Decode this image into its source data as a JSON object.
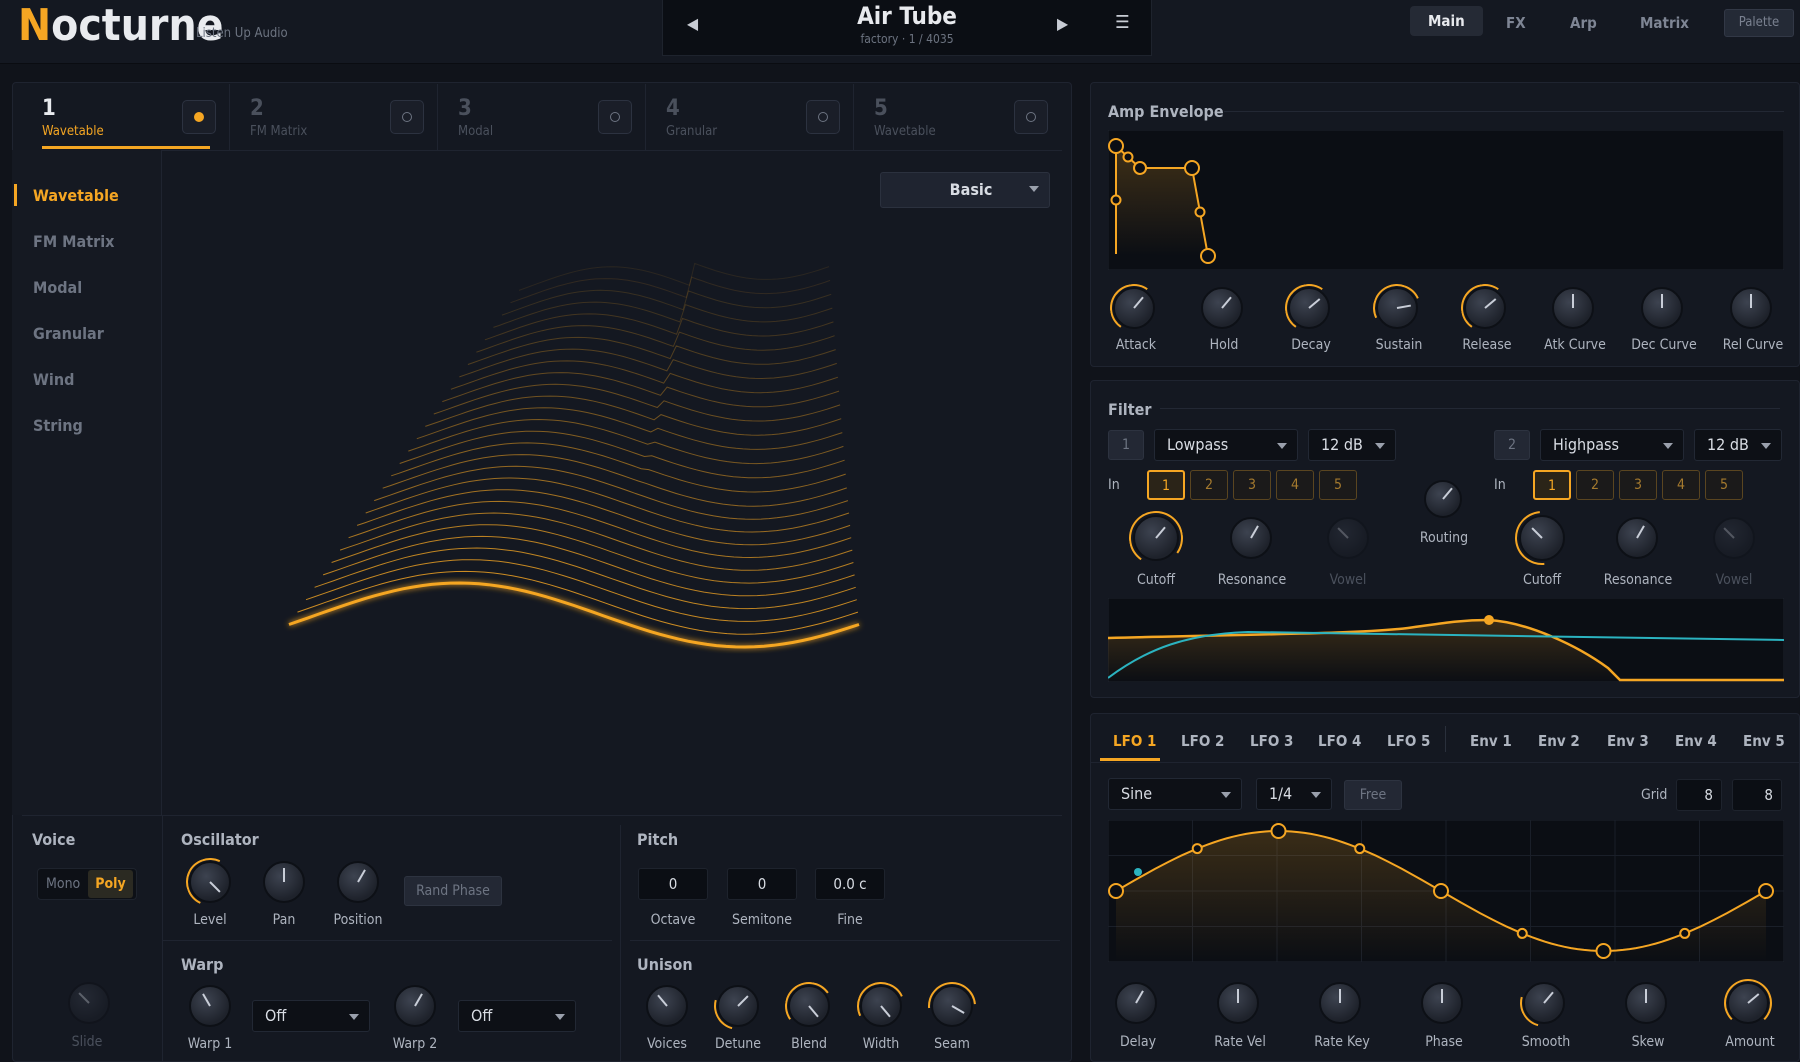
{
  "app": {
    "name_first": "N",
    "name_rest": "octurne",
    "vendor": "Listen Up Audio"
  },
  "preset": {
    "name": "Air Tube",
    "sub": "factory · 1 / 4035",
    "prev": "◀",
    "next": "▶",
    "menu": "☰"
  },
  "top_tabs": [
    {
      "label": "Main"
    },
    {
      "label": "FX"
    },
    {
      "label": "Arp"
    },
    {
      "label": "Matrix"
    }
  ],
  "palette_label": "Palette",
  "osc_tabs": [
    {
      "num": "1",
      "name": "Wavetable"
    },
    {
      "num": "2",
      "name": "FM Matrix"
    },
    {
      "num": "3",
      "name": "Modal"
    },
    {
      "num": "4",
      "name": "Granular"
    },
    {
      "num": "5",
      "name": "Wavetable"
    }
  ],
  "engine_list": [
    "Wavetable",
    "FM Matrix",
    "Modal",
    "Granular",
    "Wind",
    "String"
  ],
  "wavetable_preset": "Basic",
  "voice": {
    "title": "Voice",
    "mono": "Mono",
    "poly": "Poly",
    "slide": "Slide"
  },
  "oscillator": {
    "title": "Oscillator",
    "level": "Level",
    "pan": "Pan",
    "position": "Position",
    "rand_phase": "Rand Phase"
  },
  "warp": {
    "title": "Warp",
    "warp1": "Warp 1",
    "warp1_val": "Off",
    "warp2": "Warp 2",
    "warp2_val": "Off"
  },
  "pitch": {
    "title": "Pitch",
    "octave": "0",
    "semitone": "0",
    "fine": "0.0 c",
    "octave_l": "Octave",
    "semitone_l": "Semitone",
    "fine_l": "Fine"
  },
  "unison": {
    "title": "Unison",
    "voices": "Voices",
    "detune": "Detune",
    "blend": "Blend",
    "width": "Width",
    "seam": "Seam"
  },
  "amp_env": {
    "title": "Amp Envelope",
    "knobs": [
      "Attack",
      "Hold",
      "Decay",
      "Sustain",
      "Release",
      "Atk Curve",
      "Dec Curve",
      "Rel Curve"
    ]
  },
  "filter": {
    "title": "Filter",
    "f1": {
      "id": "1",
      "type": "Lowpass",
      "slope": "12 dB"
    },
    "f2": {
      "id": "2",
      "type": "Highpass",
      "slope": "12 dB"
    },
    "in_label": "In",
    "chips": [
      "1",
      "2",
      "3",
      "4",
      "5"
    ],
    "routing": "Routing",
    "cutoff": "Cutoff",
    "resonance": "Resonance",
    "vowel": "Vowel"
  },
  "mod": {
    "tabs": [
      "LFO 1",
      "LFO 2",
      "LFO 3",
      "LFO 4",
      "LFO 5",
      "Env 1",
      "Env 2",
      "Env 3",
      "Env 4",
      "Env 5"
    ],
    "shape": "Sine",
    "rate": "1/4",
    "free": "Free",
    "grid_label": "Grid",
    "grid_x": "8",
    "grid_y": "8",
    "knobs": [
      "Delay",
      "Rate Vel",
      "Rate Key",
      "Phase",
      "Smooth",
      "Skew",
      "Amount"
    ]
  },
  "colors": {
    "accent": "#f5a623",
    "teal": "#2bb3c0",
    "bg": "#10131a"
  }
}
